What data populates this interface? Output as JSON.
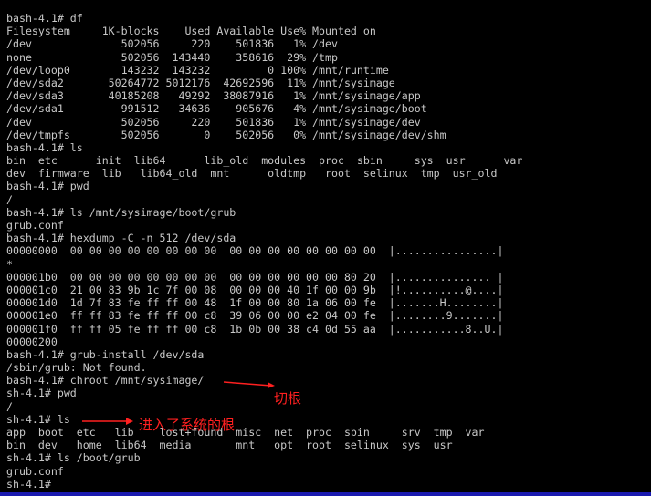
{
  "terminal": {
    "lines": [
      "bash-4.1# df",
      "Filesystem     1K-blocks    Used Available Use% Mounted on",
      "/dev              502056     220    501836   1% /dev",
      "none              502056  143440    358616  29% /tmp",
      "/dev/loop0        143232  143232         0 100% /mnt/runtime",
      "/dev/sda2       50264772 5012176  42692596  11% /mnt/sysimage",
      "/dev/sda3       40185208   49292  38087916   1% /mnt/sysimage/app",
      "/dev/sda1         991512   34636    905676   4% /mnt/sysimage/boot",
      "/dev              502056     220    501836   1% /mnt/sysimage/dev",
      "/dev/tmpfs        502056       0    502056   0% /mnt/sysimage/dev/shm",
      "bash-4.1# ls",
      "bin  etc      init  lib64      lib_old  modules  proc  sbin     sys  usr      var",
      "dev  firmware  lib   lib64_old  mnt      oldtmp   root  selinux  tmp  usr_old",
      "bash-4.1# pwd",
      "/",
      "bash-4.1# ls /mnt/sysimage/boot/grub",
      "grub.conf",
      "bash-4.1# hexdump -C -n 512 /dev/sda",
      "00000000  00 00 00 00 00 00 00 00  00 00 00 00 00 00 00 00  |................|",
      "*",
      "000001b0  00 00 00 00 00 00 00 00  00 00 00 00 00 00 80 20  |............... |",
      "000001c0  21 00 83 9b 1c 7f 00 08  00 00 00 40 1f 00 00 9b  |!..........@....|",
      "000001d0  1d 7f 83 fe ff ff 00 48  1f 00 00 80 1a 06 00 fe  |.......H........|",
      "000001e0  ff ff 83 fe ff ff 00 c8  39 06 00 00 e2 04 00 fe  |........9.......|",
      "000001f0  ff ff 05 fe ff ff 00 c8  1b 0b 00 38 c4 0d 55 aa  |...........8..U.|",
      "00000200",
      "bash-4.1# grub-install /dev/sda",
      "/sbin/grub: Not found.",
      "bash-4.1# chroot /mnt/sysimage/",
      "sh-4.1# pwd",
      "/",
      "sh-4.1# ls",
      "app  boot  etc   lib    lost+found  misc  net  proc  sbin     srv  tmp  var",
      "bin  dev   home  lib64  media       mnt   opt  root  selinux  sys  usr",
      "sh-4.1# ls /boot/grub",
      "grub.conf",
      "sh-4.1#"
    ]
  },
  "annotations": {
    "chroot_note": "切根",
    "root_note": "进入了系统的根",
    "color": "#ff2020"
  }
}
